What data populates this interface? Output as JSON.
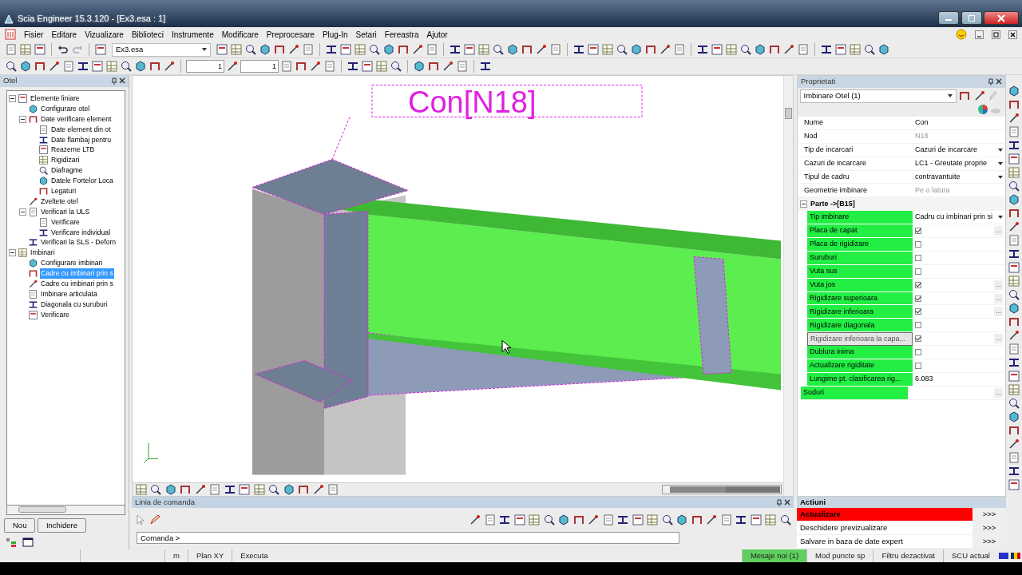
{
  "window": {
    "title": "Scia Engineer 15.3.120 - [Ex3.esa : 1]"
  },
  "menu": [
    "Fisier",
    "Editare",
    "Vizualizare",
    "Biblioteci",
    "Instrumente",
    "Modificare",
    "Preprocesare",
    "Plug-In",
    "Setari",
    "Fereastra",
    "Ajutor"
  ],
  "toolbar": {
    "project": "Ex3.esa",
    "spin_values": [
      "1",
      "1"
    ]
  },
  "tree_panel": {
    "title": "Otel",
    "items": [
      {
        "label": "Elemente liniare",
        "expanded": true,
        "selected": false,
        "children": [
          {
            "label": "Configurare otel",
            "selected": false
          },
          {
            "label": "Date verificare element",
            "expanded": true,
            "selected": false,
            "children": [
              {
                "label": "Date element din ot",
                "selected": false
              },
              {
                "label": "Date flambaj pentru",
                "selected": false
              },
              {
                "label": "Reazeme LTB",
                "selected": false
              },
              {
                "label": "Rigidizari",
                "selected": false
              },
              {
                "label": "Diafragme",
                "selected": false
              },
              {
                "label": "Datele Fortelor Loca",
                "selected": false
              },
              {
                "label": "Legaturi",
                "selected": false
              }
            ]
          },
          {
            "label": "Zveltete otel",
            "selected": false
          },
          {
            "label": "Verificari la ULS",
            "expanded": true,
            "selected": false,
            "children": [
              {
                "label": "Verificare",
                "selected": false
              },
              {
                "label": "Verificare individual",
                "selected": false
              }
            ]
          },
          {
            "label": "Verificari la SLS - Deforn",
            "selected": false
          }
        ]
      },
      {
        "label": "Imbinari",
        "expanded": true,
        "selected": false,
        "children": [
          {
            "label": "Configurare imbinari",
            "selected": false
          },
          {
            "label": "Cadre cu imbinari prin s",
            "selected": true
          },
          {
            "label": "Cadre cu imbinari prin s",
            "selected": false
          },
          {
            "label": "Imbinare articulata",
            "selected": false
          },
          {
            "label": "Diagonala cu suruburi",
            "selected": false
          },
          {
            "label": "Verificare",
            "selected": false
          }
        ]
      }
    ],
    "buttons": [
      "Nou",
      "Inchidere"
    ]
  },
  "viewport": {
    "label": "Con[N18]"
  },
  "command_panel": {
    "title": "Linia de comanda",
    "prompt": "Comanda >"
  },
  "properties": {
    "title": "Proprietati",
    "selector": "Imbinare Otel (1)",
    "rows": [
      {
        "label": "Nume",
        "value": "Con",
        "kind": "text",
        "disabled": false
      },
      {
        "label": "Nod",
        "value": "N18",
        "kind": "text",
        "disabled": true
      },
      {
        "label": "Tip de incarcari",
        "value": "Cazuri de incarcare",
        "kind": "dropdown",
        "disabled": false
      },
      {
        "label": "Cazuri de incarcare",
        "value": "LC1 - Greutate proprie",
        "kind": "dropdown",
        "disabled": false
      },
      {
        "label": "Tipul de cadru",
        "value": "contravantuite",
        "kind": "dropdown",
        "disabled": false
      },
      {
        "label": "Geometrie imbinare",
        "value": "Pe o latura",
        "kind": "text",
        "disabled": true
      }
    ],
    "section": {
      "title": "Parte ->[B15]",
      "expanded": true,
      "rows": [
        {
          "label": "Tip imbinare",
          "kind": "dropdown",
          "value": "Cadru cu imbinari prin si",
          "focused": false
        },
        {
          "label": "Placa de capat",
          "kind": "check",
          "checked": true,
          "more": "...",
          "focused": false
        },
        {
          "label": "Placa de rigidizare",
          "kind": "check",
          "checked": false,
          "focused": false
        },
        {
          "label": "Suruburi",
          "kind": "check",
          "checked": false,
          "focused": false
        },
        {
          "label": "Vuta sus",
          "kind": "check",
          "checked": false,
          "focused": false
        },
        {
          "label": "Vuta jos",
          "kind": "check",
          "checked": true,
          "more": "...",
          "focused": false
        },
        {
          "label": "Rigidizare superioara",
          "kind": "check",
          "checked": true,
          "more": "...",
          "focused": false
        },
        {
          "label": "Rigidizare inferioara",
          "kind": "check",
          "checked": true,
          "more": "...",
          "focused": false
        },
        {
          "label": "Rigidizare diagonala",
          "kind": "check",
          "checked": false,
          "focused": false
        },
        {
          "label": "Rigidizare inferioara la capa...",
          "kind": "check",
          "checked": true,
          "more": "...",
          "focused": true
        },
        {
          "label": "Dublura inima",
          "kind": "check",
          "checked": false,
          "focused": false
        },
        {
          "label": "Actualizare rigiditate",
          "kind": "check",
          "checked": false,
          "focused": false
        },
        {
          "label": "Lungime pt. clasificarea rig...",
          "kind": "text",
          "value": "6.083",
          "focused": false
        },
        {
          "label": "Suduri",
          "kind": "group",
          "more": "...",
          "focused": false
        }
      ]
    }
  },
  "actions": {
    "title": "Actiuni",
    "items": [
      {
        "label": "Actualizare",
        "button": ">>>",
        "highlighted": true
      },
      {
        "label": "Deschidere previzualizare",
        "button": ">>>",
        "highlighted": false
      },
      {
        "label": "Salvare in baza de date expert",
        "button": ">>>",
        "highlighted": false
      }
    ]
  },
  "status_bar": {
    "left": [
      "m",
      "Plan XY",
      "Executa"
    ],
    "right": [
      {
        "text": "Mesaje noi (1)",
        "highlighted": true
      },
      {
        "text": "Mod puncte sp",
        "highlighted": false
      },
      {
        "text": "Filtru dezactivat",
        "highlighted": false
      },
      {
        "text": "SCU actual",
        "highlighted": false
      }
    ]
  }
}
